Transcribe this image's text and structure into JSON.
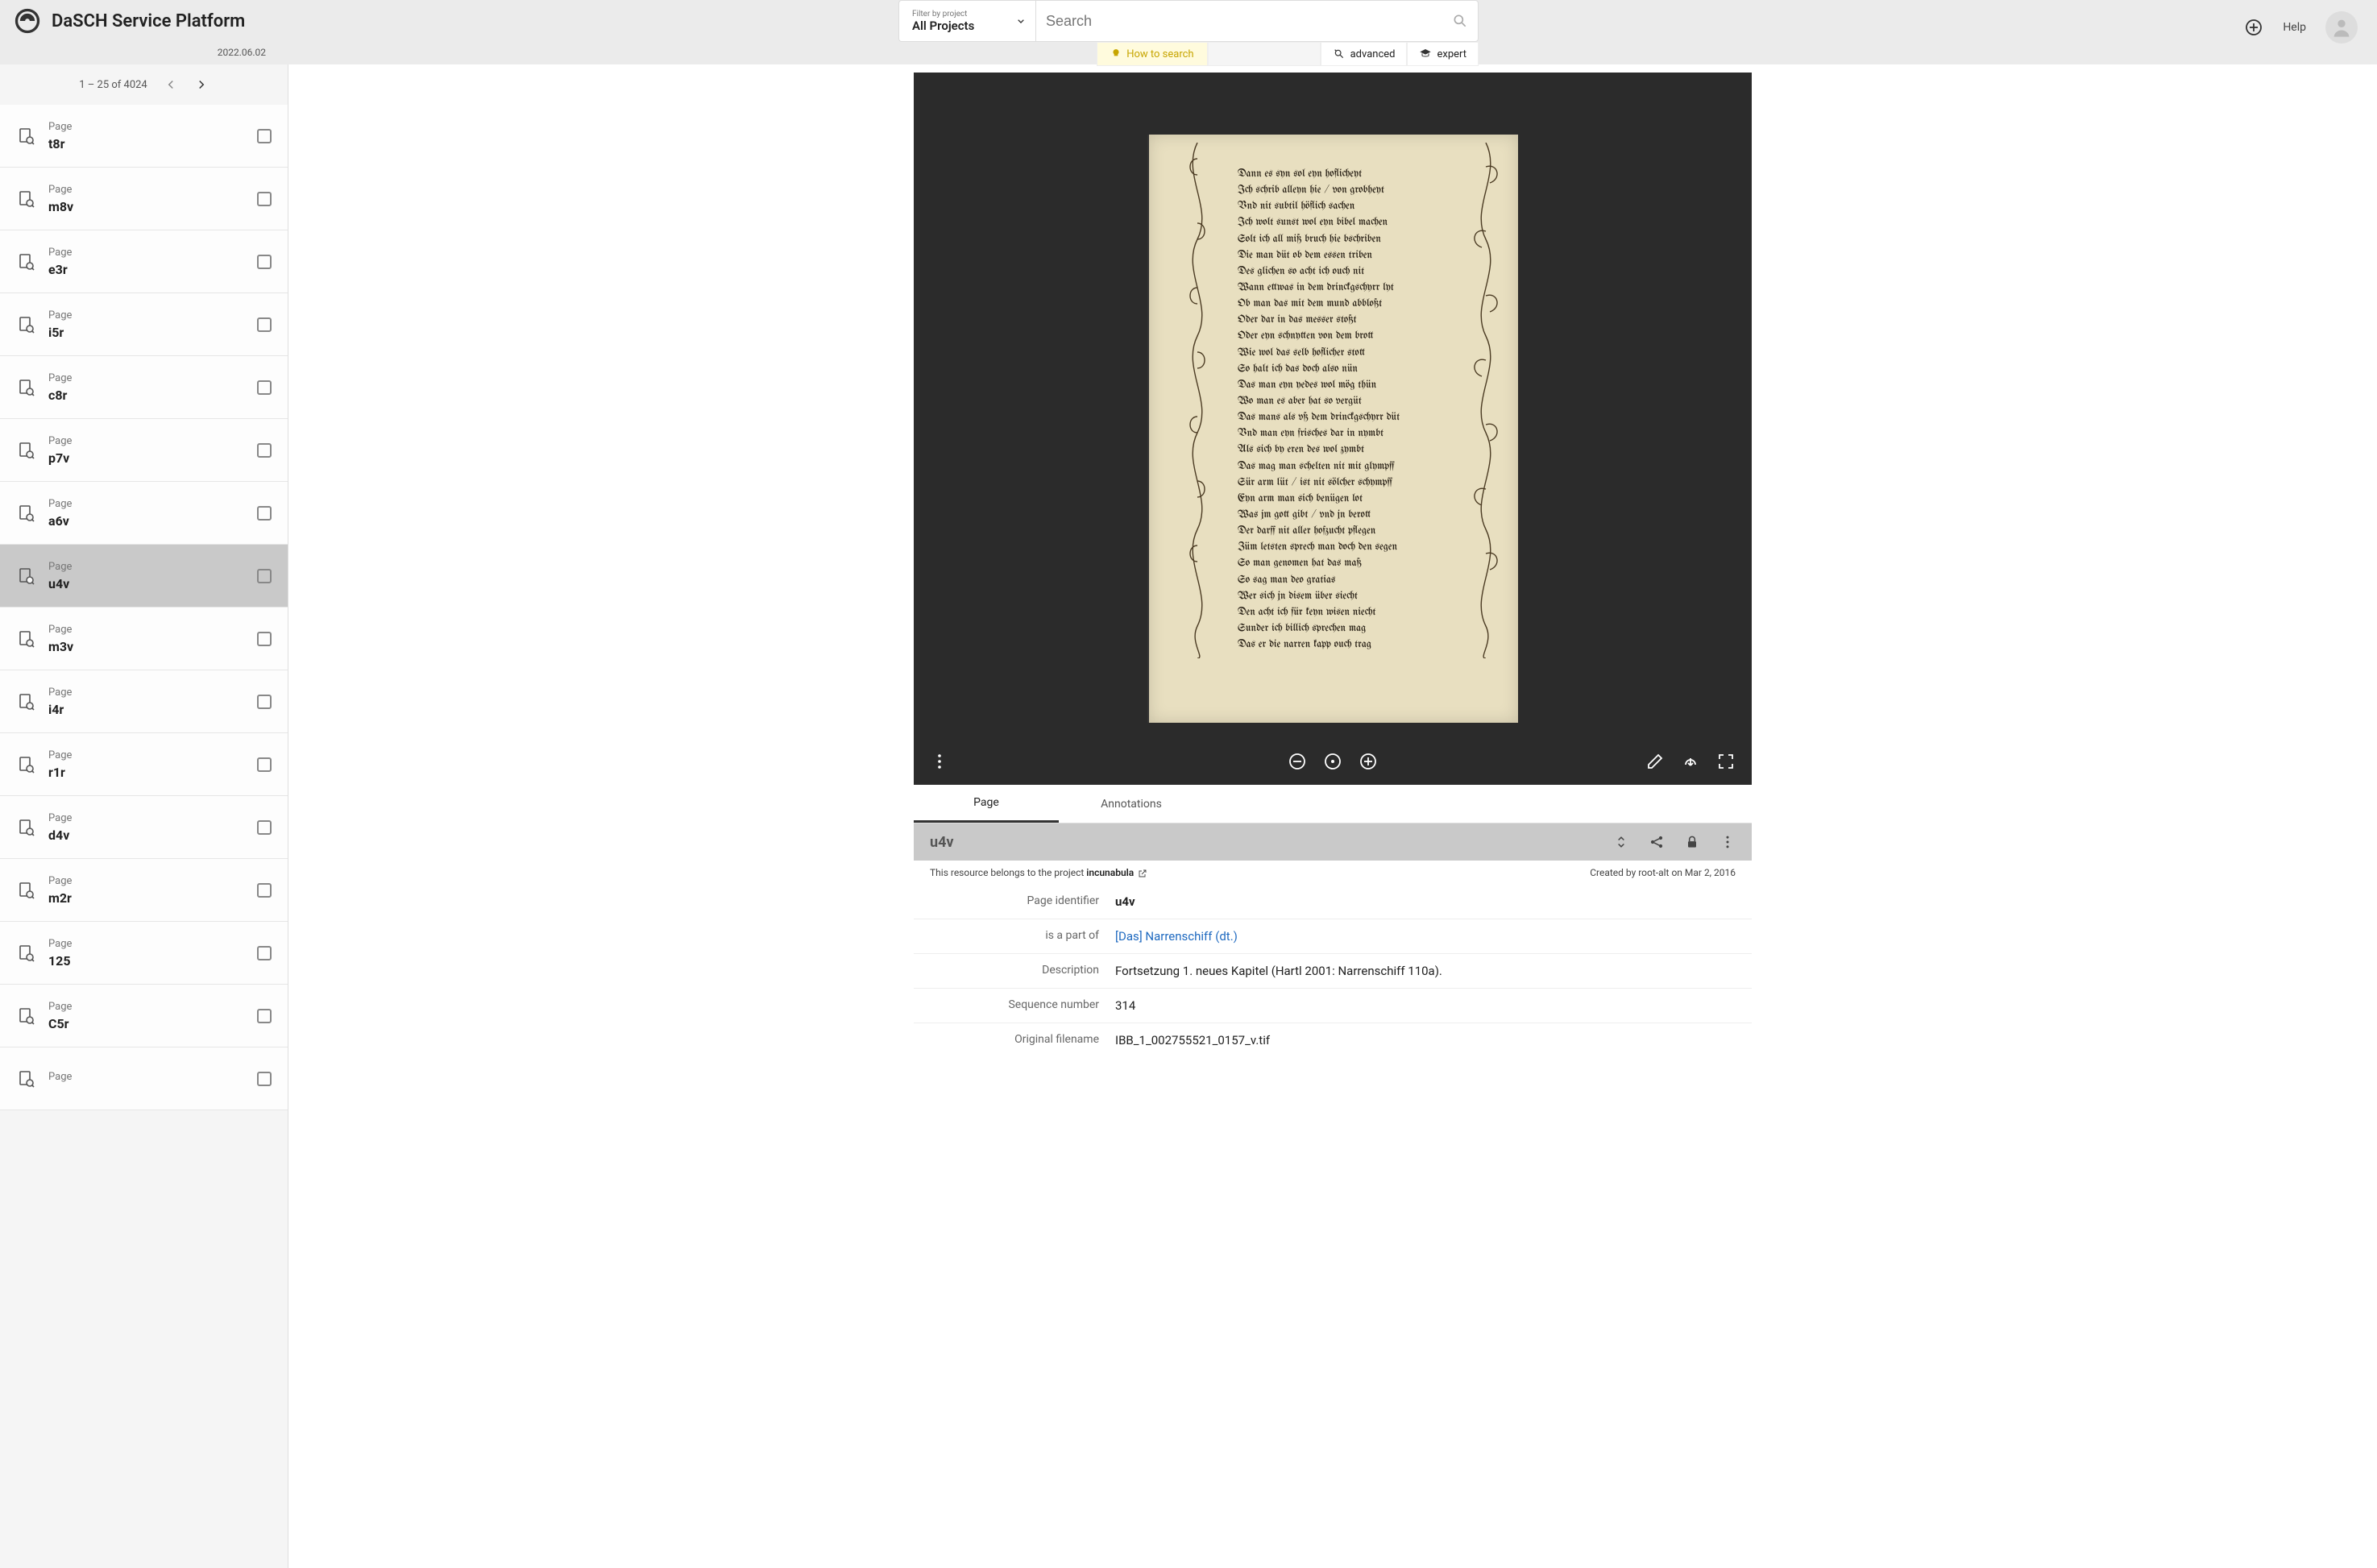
{
  "header": {
    "brand": "DaSCH Service Platform",
    "version": "2022.06.02",
    "filter_label": "Filter by project",
    "filter_value": "All Projects",
    "search_placeholder": "Search",
    "how_to": "How to search",
    "advanced": "advanced",
    "expert": "expert",
    "help": "Help"
  },
  "sidebar": {
    "pager": "1 – 25 of 4024",
    "items": [
      {
        "type": "Page",
        "title": "t8r"
      },
      {
        "type": "Page",
        "title": "m8v"
      },
      {
        "type": "Page",
        "title": "e3r"
      },
      {
        "type": "Page",
        "title": "i5r"
      },
      {
        "type": "Page",
        "title": "c8r"
      },
      {
        "type": "Page",
        "title": "p7v"
      },
      {
        "type": "Page",
        "title": "a6v"
      },
      {
        "type": "Page",
        "title": "u4v"
      },
      {
        "type": "Page",
        "title": "m3v"
      },
      {
        "type": "Page",
        "title": "i4r"
      },
      {
        "type": "Page",
        "title": "r1r"
      },
      {
        "type": "Page",
        "title": "d4v"
      },
      {
        "type": "Page",
        "title": "m2r"
      },
      {
        "type": "Page",
        "title": "125"
      },
      {
        "type": "Page",
        "title": "C5r"
      },
      {
        "type": "Page",
        "title": ""
      }
    ],
    "selected": 7
  },
  "viewer": {
    "manuscript_lines": [
      "Dann es syn sol eyn hoflicheyt",
      "Ich schrib alleyn hie / von grobheyt",
      "Vnd nit subtil höflich sachen",
      "Ich wolt sunst wol eyn bibel machen",
      "Solt ich all miß bruch hie bschriben",
      "Die man düt ob dem essen triben",
      "Des glichen so acht ich ouch nit",
      "Wann ettwas in dem drinckgschyrr lyt",
      "Ob man das mit dem mund abbloßt",
      "Oder dar in das messer stoßt",
      "Oder eyn schnytten von dem brott",
      "Wie wol das selb hoflicher stott",
      "So halt ich das doch also nün",
      "Das man eyn yedes wol mög thün",
      "Wo man es aber hat so vergüt",
      "Das mans als vß dem drinckgschyrr düt",
      "Vnd man eyn frisches dar in nymbt",
      "Als sich by eren des wol zymbt",
      "Das mag man schelten nit mit glympff",
      "Sür arm lüt / ist nit sölcher schympff",
      "Eyn arm man sich benügen lot",
      "Was jm gott gibt / vnd jn berott",
      "Der darff nit aller hofzucht pflegen",
      "Züm letsten sprech man doch den segen",
      "So man genomen hat das maß",
      "So sag man deo gratias",
      "Wer sich jn disem über siecht",
      "Den acht ich für keyn wisen niecht",
      "Sunder ich billich sprechen mag",
      "Das er die narren kapp ouch trag"
    ]
  },
  "tabs": {
    "page": "Page",
    "annotations": "Annotations"
  },
  "resource": {
    "title": "u4v",
    "belongs_prefix": "This resource belongs to the project ",
    "belongs_project": "incunabula",
    "created": "Created by root-alt on Mar 2, 2016",
    "props": [
      {
        "label": "Page identifier",
        "value": "u4v",
        "bold": true
      },
      {
        "label": "is a part of",
        "value": "[Das] Narrenschiff (dt.)",
        "link": true
      },
      {
        "label": "Description",
        "value": "Fortsetzung 1. neues Kapitel (Hartl 2001: Narrenschiff 110a)."
      },
      {
        "label": "Sequence number",
        "value": "314"
      },
      {
        "label": "Original filename",
        "value": "IBB_1_002755521_0157_v.tif"
      }
    ]
  }
}
